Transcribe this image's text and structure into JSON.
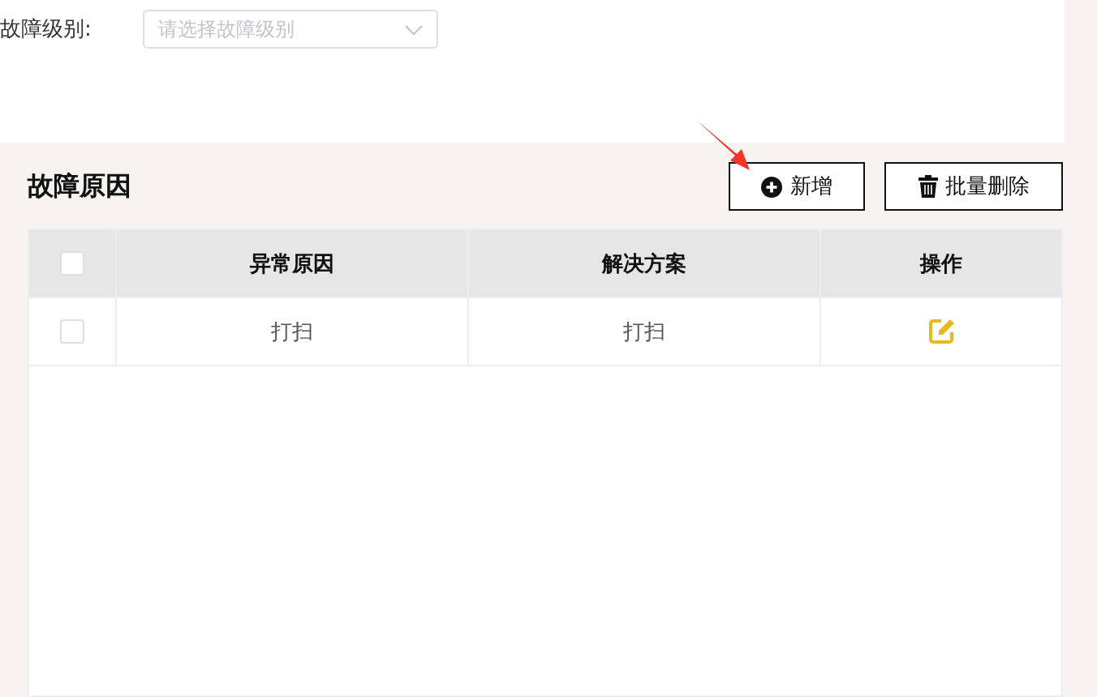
{
  "form": {
    "label": "故障级别:",
    "select": {
      "placeholder": "请选择故障级别"
    }
  },
  "section": {
    "title": "故障原因",
    "buttons": [
      {
        "kind": "add",
        "label": "新增"
      },
      {
        "kind": "delete",
        "label": "批量删除"
      }
    ]
  },
  "table": {
    "select_all": {
      "checked": false
    },
    "columns": [
      "异常原因",
      "解决方案",
      "操作"
    ],
    "rows": [
      {
        "checked": false,
        "cells": [
          "打扫",
          "打扫"
        ]
      }
    ]
  }
}
